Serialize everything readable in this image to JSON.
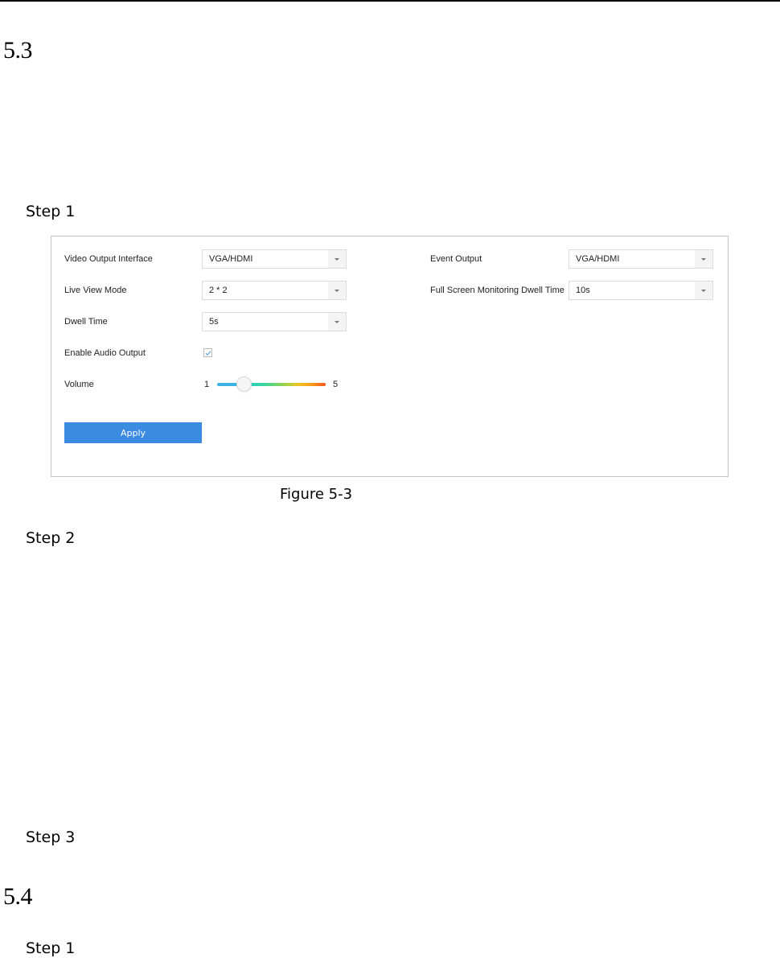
{
  "document": {
    "sections": [
      {
        "number": "5.3"
      },
      {
        "number": "5.4"
      }
    ],
    "steps": {
      "s53_step1": "Step 1",
      "s53_step2": "Step 2",
      "s53_step3": "Step 3",
      "s54_step1": "Step 1"
    },
    "figure_caption": "Figure 5-3"
  },
  "settings_form": {
    "video_output_interface": {
      "label": "Video Output Interface",
      "value": "VGA/HDMI"
    },
    "live_view_mode": {
      "label": "Live View Mode",
      "value": "2 * 2"
    },
    "dwell_time": {
      "label": "Dwell Time",
      "value": "5s"
    },
    "enable_audio_output": {
      "label": "Enable Audio Output",
      "checked": true
    },
    "volume": {
      "label": "Volume",
      "min": "1",
      "max": "5",
      "value": 2
    },
    "event_output": {
      "label": "Event Output",
      "value": "VGA/HDMI"
    },
    "full_screen_dwell_time": {
      "label": "Full Screen Monitoring Dwell Time",
      "value": "10s"
    },
    "apply_label": "Apply"
  },
  "colors": {
    "apply_button": "#3b8be3",
    "figure_border": "#c4c4c4",
    "slider_low": "#3db3e3",
    "slider_high": "#f2531a"
  }
}
